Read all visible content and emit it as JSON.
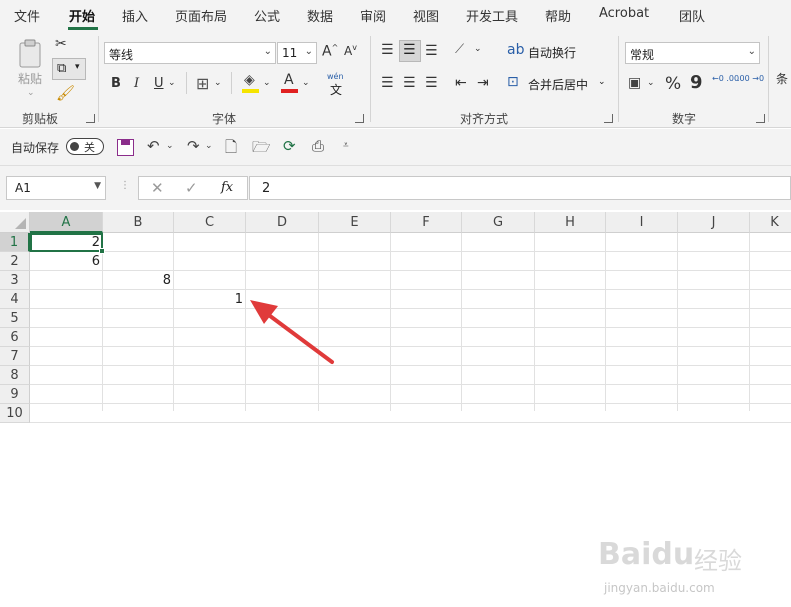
{
  "menu": {
    "tabs": [
      "文件",
      "开始",
      "插入",
      "页面布局",
      "公式",
      "数据",
      "审阅",
      "视图",
      "开发工具",
      "帮助",
      "Acrobat",
      "团队"
    ],
    "active": "开始"
  },
  "ribbon": {
    "clipboard": {
      "paste_label": "粘贴",
      "group_label": "剪贴板"
    },
    "font": {
      "font_name": "等线",
      "font_size": "11",
      "bold": "B",
      "italic": "I",
      "underline": "U",
      "grow": "A",
      "shrink": "A",
      "phonetic": "wén",
      "phonetic_sub": "文",
      "group_label": "字体",
      "fill_color": "#f5e400",
      "font_color": "#e02020"
    },
    "alignment": {
      "wrap_label": "自动换行",
      "merge_label": "合并后居中",
      "group_label": "对齐方式"
    },
    "number": {
      "format": "常规",
      "percent": "%",
      "comma": "9",
      "inc_decimal": "←0 .00",
      "dec_decimal": ".00 →0",
      "group_label": "数字"
    },
    "styles": {
      "cut_label": "条"
    }
  },
  "qat": {
    "autosave_label": "自动保存",
    "toggle_state": "关"
  },
  "formula_bar": {
    "name_box": "A1",
    "fx": "fx",
    "formula": "2"
  },
  "grid": {
    "columns": [
      "A",
      "B",
      "C",
      "D",
      "E",
      "F",
      "G",
      "H",
      "I",
      "J",
      "K"
    ],
    "rows": [
      "1",
      "2",
      "3",
      "4",
      "5",
      "6",
      "7",
      "8",
      "9",
      "10"
    ],
    "selected_cell": "A1",
    "cells": [
      {
        "ref": "A1",
        "value": "2"
      },
      {
        "ref": "A2",
        "value": "6"
      },
      {
        "ref": "B3",
        "value": "8"
      },
      {
        "ref": "C4",
        "value": "1"
      }
    ]
  },
  "annotation": {
    "arrow_color": "#e03a3a"
  },
  "watermark": {
    "brand": "Baidu",
    "brand_cn": "经验",
    "url": "jingyan.baidu.com"
  },
  "colors": {
    "accent": "#217346"
  }
}
